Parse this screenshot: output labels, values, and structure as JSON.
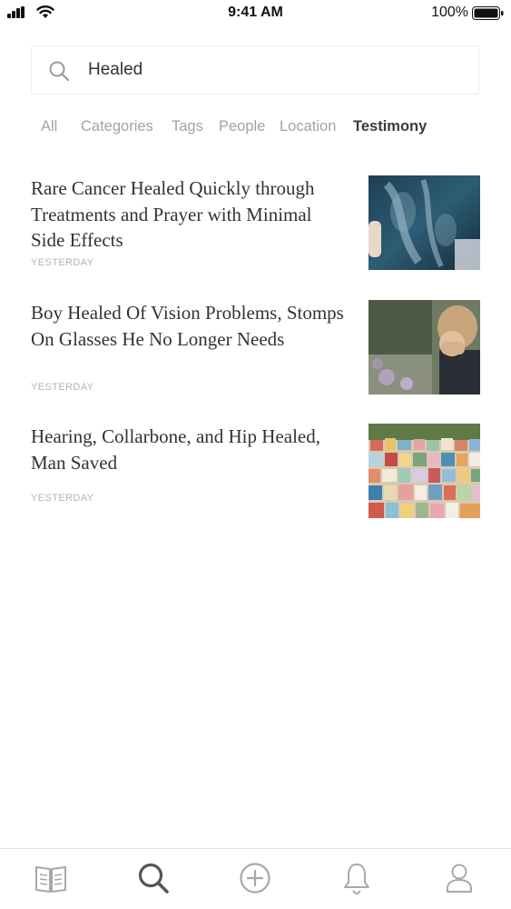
{
  "status_bar": {
    "time": "9:41 AM",
    "battery_percent": "100%"
  },
  "search": {
    "value": "Healed",
    "icon": "search-icon"
  },
  "filters": {
    "tabs": [
      {
        "label": "All",
        "active": false
      },
      {
        "label": "Categories",
        "active": false
      },
      {
        "label": "Tags",
        "active": false
      },
      {
        "label": "People",
        "active": false
      },
      {
        "label": "Location",
        "active": false
      },
      {
        "label": "Testimony",
        "active": true
      }
    ]
  },
  "results": [
    {
      "title": "Rare Cancer Healed Quickly through Treatments and Prayer with Minimal Side Effects",
      "time": "YESTERDAY",
      "thumbnail": "x-ray-photo"
    },
    {
      "title": "Boy Healed Of Vision Problems, Stomps On Glasses He No Longer Needs",
      "time": "YESTERDAY",
      "thumbnail": "boy-covering-face-photo"
    },
    {
      "title": "Hearing, Collarbone, and Hip Healed, Man Saved",
      "time": "YESTERDAY",
      "thumbnail": "colorful-town-photo"
    }
  ],
  "tab_bar": {
    "items": [
      {
        "icon": "book-icon",
        "active": false
      },
      {
        "icon": "search-icon",
        "active": true
      },
      {
        "icon": "add-circle-icon",
        "active": false
      },
      {
        "icon": "bell-icon",
        "active": false
      },
      {
        "icon": "profile-icon",
        "active": false
      }
    ]
  },
  "colors": {
    "tab_active": "#555555",
    "tab_inactive": "#a8a8a8",
    "filter_active": "#3a3a3a",
    "filter_inactive": "#a3a3a3"
  }
}
